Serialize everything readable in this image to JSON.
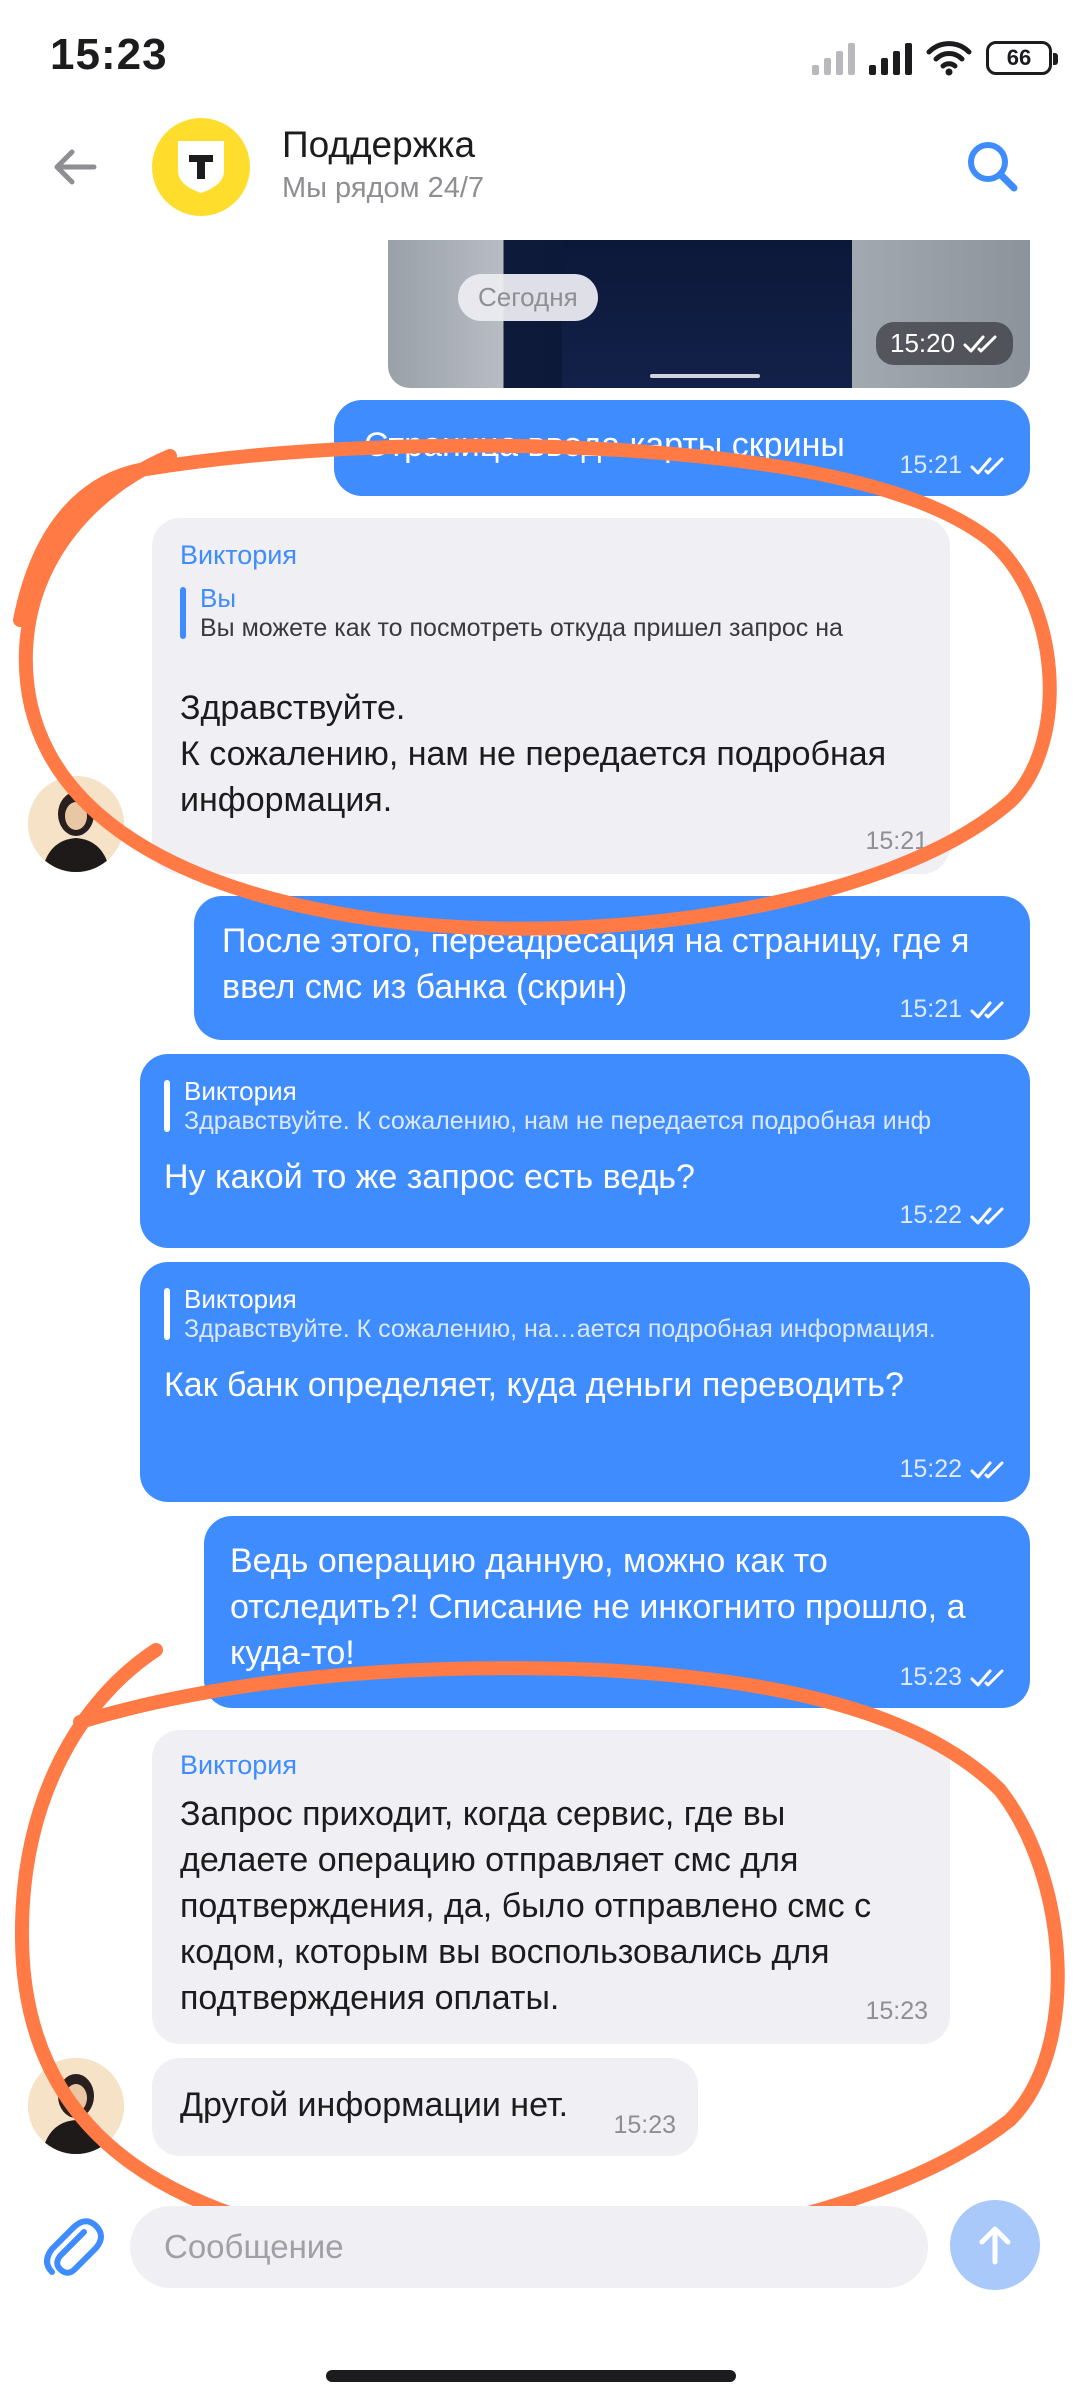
{
  "status_bar": {
    "time": "15:23",
    "battery": "66"
  },
  "header": {
    "title": "Поддержка",
    "subtitle": "Мы рядом 24/7"
  },
  "date_chip": "Сегодня",
  "image_message": {
    "time": "15:20"
  },
  "messages": [
    {
      "direction": "outgoing",
      "text": "Страница ввода карты скрины",
      "time": "15:21"
    },
    {
      "direction": "incoming",
      "sender": "Виктория",
      "quote_name": "Вы",
      "quote_text": "Вы можете как то посмотреть откуда пришел запрос на",
      "text": "Здравствуйте.\nК сожалению, нам не передается подробная информация.",
      "time": "15:21"
    },
    {
      "direction": "outgoing",
      "text": "После этого, переадресация на страницу, где я ввел смс из банка (скрин)",
      "time": "15:21"
    },
    {
      "direction": "outgoing",
      "quote_name": "Виктория",
      "quote_text": "Здравствуйте. К сожалению, нам не передается подробная инф",
      "text": "Ну какой то же запрос есть ведь?",
      "time": "15:22"
    },
    {
      "direction": "outgoing",
      "quote_name": "Виктория",
      "quote_text": "Здравствуйте. К сожалению, на…ается подробная информация.",
      "text": "Как банк определяет, куда деньги переводить?",
      "time": "15:22"
    },
    {
      "direction": "outgoing",
      "text": "Ведь операцию данную, можно как то отследить?! Списание не инкогнито прошло, а куда-то!",
      "time": "15:23"
    },
    {
      "direction": "incoming",
      "sender": "Виктория",
      "text": "Запрос приходит, когда сервис, где вы делаете операцию отправляет смс для подтверждения, да, было отправлено смс с кодом, которым вы воспользовались для подтверждения оплаты.",
      "time": "15:23"
    },
    {
      "direction": "incoming",
      "text": "Другой информации нет.",
      "time": "15:23"
    }
  ],
  "composer": {
    "placeholder": "Сообщение"
  },
  "colors": {
    "accent": "#3f8cff",
    "brand_yellow": "#ffdd2d",
    "annotation": "#ff7a45"
  }
}
